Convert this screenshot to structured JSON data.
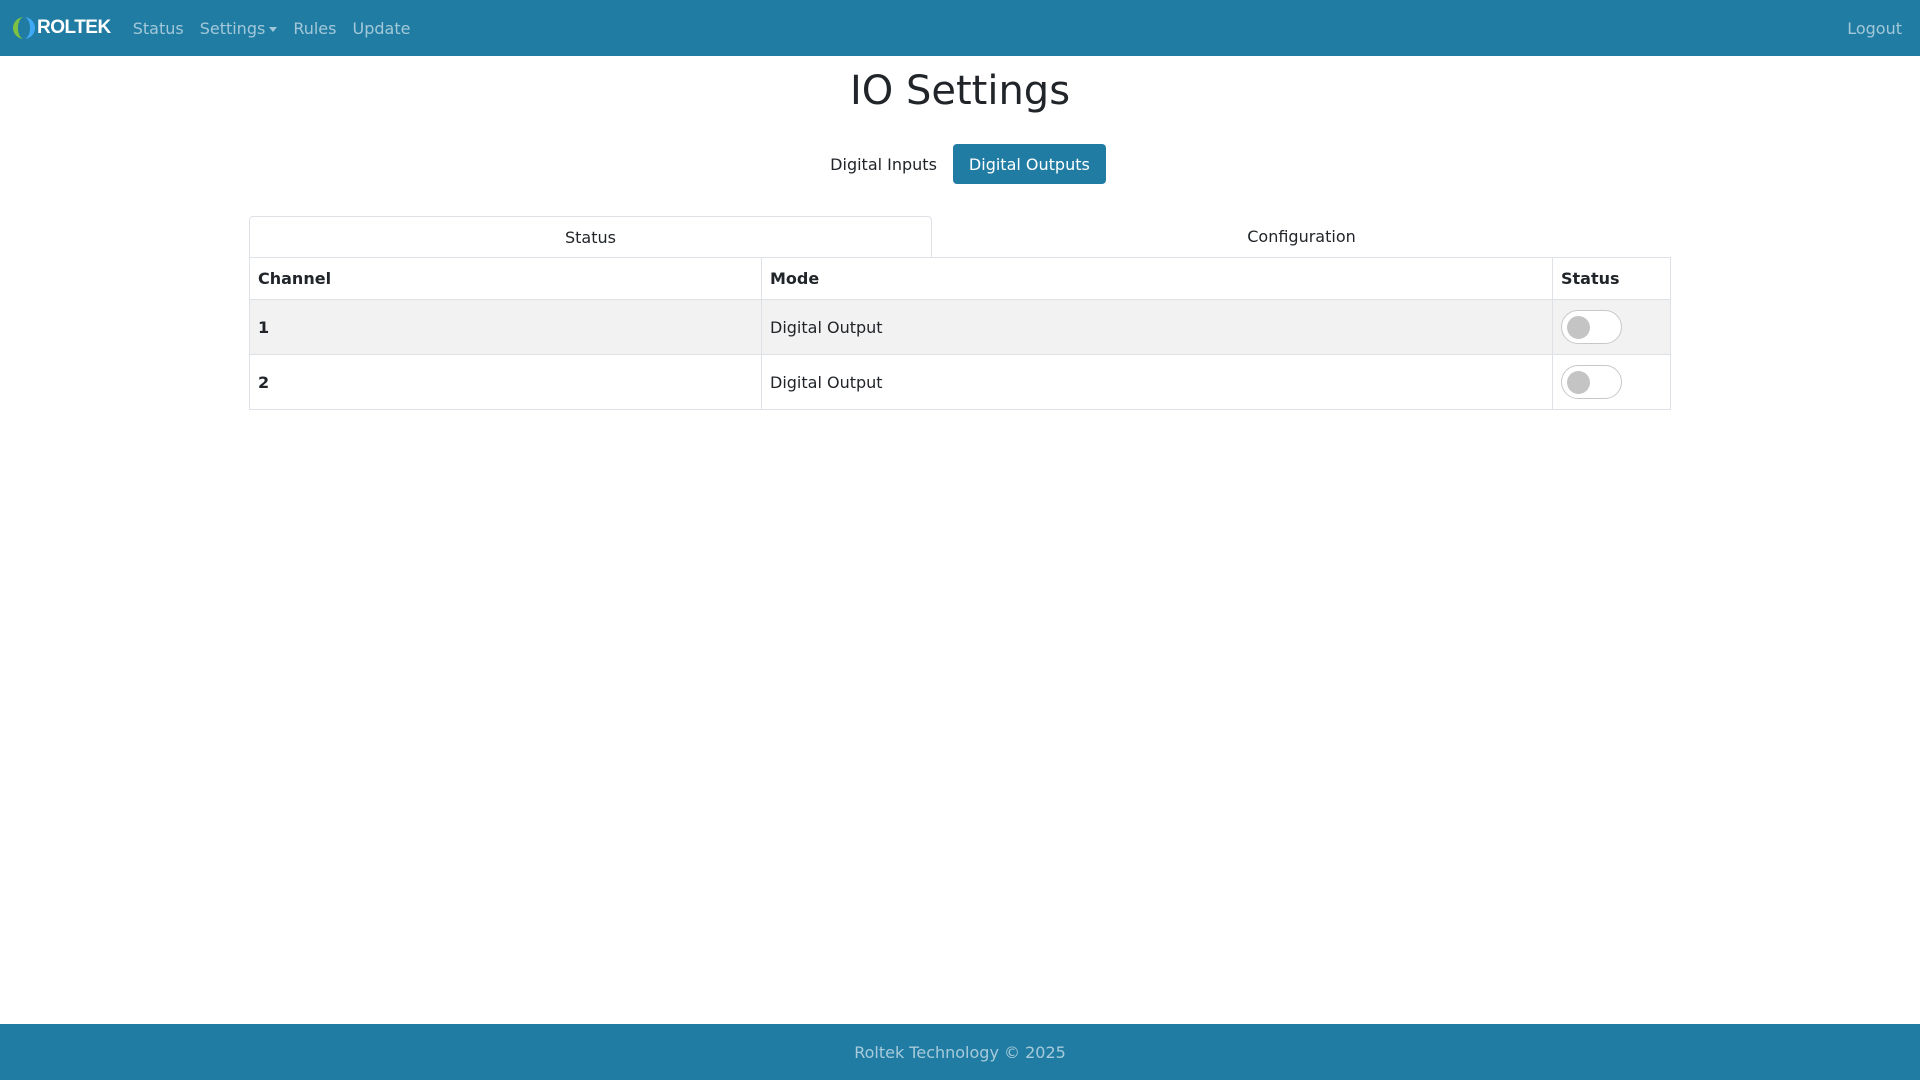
{
  "navbar": {
    "brand": "ROLTEK",
    "links": {
      "status": "Status",
      "settings": "Settings",
      "rules": "Rules",
      "update": "Update"
    },
    "logout": "Logout",
    "bg_color": "#217ca3"
  },
  "page": {
    "title": "IO Settings",
    "pills": {
      "inputs": "Digital Inputs",
      "outputs": "Digital Outputs",
      "active": "outputs"
    },
    "tabs": {
      "status": "Status",
      "configuration": "Configuration",
      "active": "status"
    }
  },
  "table": {
    "headers": {
      "channel": "Channel",
      "mode": "Mode",
      "status": "Status"
    },
    "rows": [
      {
        "channel": "1",
        "mode": "Digital Output",
        "on": false
      },
      {
        "channel": "2",
        "mode": "Digital Output",
        "on": false
      }
    ]
  },
  "footer": {
    "text": "Roltek Technology © 2025"
  },
  "icons": {
    "logo": "roltek-logo-icon",
    "dropdown": "caret-down-icon"
  },
  "colors": {
    "accent": "#217ca3",
    "logo_green": "#7cc142",
    "logo_blue": "#3fa9f5"
  }
}
